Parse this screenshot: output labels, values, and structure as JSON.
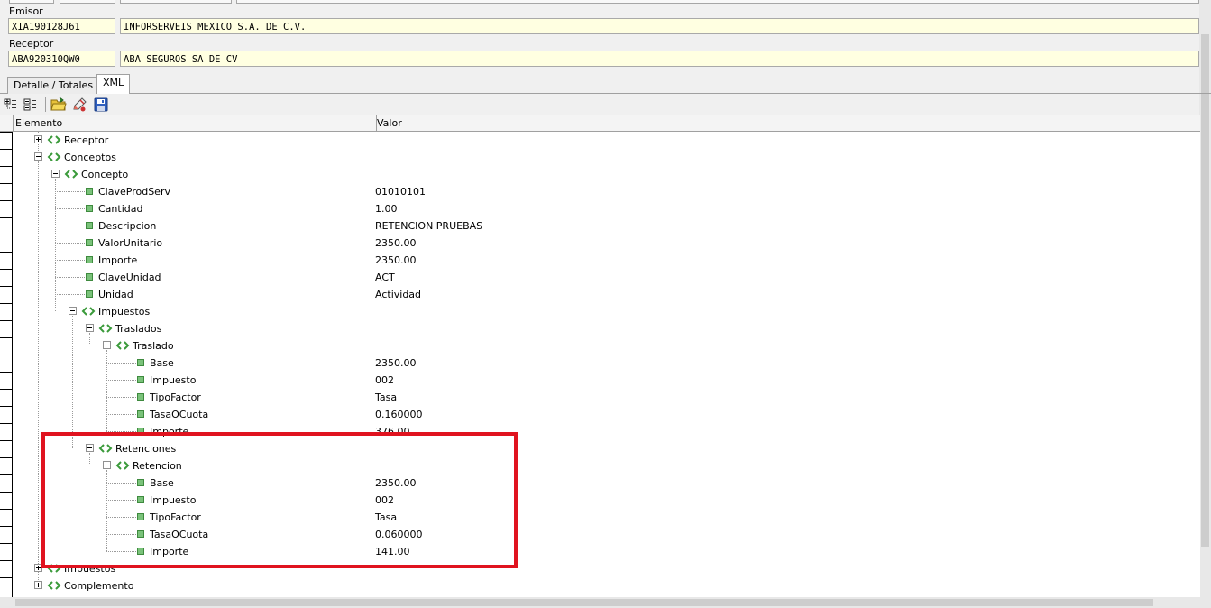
{
  "emisor": {
    "label": "Emisor",
    "rfc": "XIA190128J61",
    "name": "INFORSERVEIS MEXICO S.A. DE C.V."
  },
  "receptor": {
    "label": "Receptor",
    "rfc": "ABA920310QW0",
    "name": "ABA SEGUROS  SA DE CV"
  },
  "tabs": [
    {
      "label": "Detalle / Totales",
      "active": false
    },
    {
      "label": "XML",
      "active": true
    }
  ],
  "toolbar": {
    "buttons": [
      {
        "icon": "expand-all-icon"
      },
      {
        "icon": "collapse-all-icon"
      },
      {
        "icon": "open-folder-icon"
      },
      {
        "icon": "edit-pencil-icon"
      },
      {
        "icon": "save-disk-icon"
      }
    ]
  },
  "grid": {
    "columns": [
      "Elemento",
      "Valor"
    ],
    "rows": [
      {
        "label": "Receptor",
        "value": "",
        "level": 1,
        "type": "element",
        "expander": "plus"
      },
      {
        "label": "Conceptos",
        "value": "",
        "level": 1,
        "type": "element",
        "expander": "minus"
      },
      {
        "label": "Concepto",
        "value": "",
        "level": 2,
        "type": "element",
        "expander": "minus"
      },
      {
        "label": "ClaveProdServ",
        "value": "01010101",
        "level": 3,
        "type": "attr"
      },
      {
        "label": "Cantidad",
        "value": "1.00",
        "level": 3,
        "type": "attr"
      },
      {
        "label": "Descripcion",
        "value": "RETENCION PRUEBAS",
        "level": 3,
        "type": "attr"
      },
      {
        "label": "ValorUnitario",
        "value": "2350.00",
        "level": 3,
        "type": "attr"
      },
      {
        "label": "Importe",
        "value": "2350.00",
        "level": 3,
        "type": "attr"
      },
      {
        "label": "ClaveUnidad",
        "value": "ACT",
        "level": 3,
        "type": "attr"
      },
      {
        "label": "Unidad",
        "value": "Actividad",
        "level": 3,
        "type": "attr"
      },
      {
        "label": "Impuestos",
        "value": "",
        "level": 3,
        "type": "element",
        "expander": "minus"
      },
      {
        "label": "Traslados",
        "value": "",
        "level": 4,
        "type": "element",
        "expander": "minus"
      },
      {
        "label": "Traslado",
        "value": "",
        "level": 5,
        "type": "element",
        "expander": "minus"
      },
      {
        "label": "Base",
        "value": "2350.00",
        "level": 6,
        "type": "attr"
      },
      {
        "label": "Impuesto",
        "value": "002",
        "level": 6,
        "type": "attr"
      },
      {
        "label": "TipoFactor",
        "value": "Tasa",
        "level": 6,
        "type": "attr"
      },
      {
        "label": "TasaOCuota",
        "value": "0.160000",
        "level": 6,
        "type": "attr"
      },
      {
        "label": "Importe",
        "value": "376.00",
        "level": 6,
        "type": "attr"
      },
      {
        "label": "Retenciones",
        "value": "",
        "level": 4,
        "type": "element",
        "expander": "minus"
      },
      {
        "label": "Retencion",
        "value": "",
        "level": 5,
        "type": "element",
        "expander": "minus"
      },
      {
        "label": "Base",
        "value": "2350.00",
        "level": 6,
        "type": "attr"
      },
      {
        "label": "Impuesto",
        "value": "002",
        "level": 6,
        "type": "attr"
      },
      {
        "label": "TipoFactor",
        "value": "Tasa",
        "level": 6,
        "type": "attr"
      },
      {
        "label": "TasaOCuota",
        "value": "0.060000",
        "level": 6,
        "type": "attr"
      },
      {
        "label": "Importe",
        "value": "141.00",
        "level": 6,
        "type": "attr"
      },
      {
        "label": "Impuestos",
        "value": "",
        "level": 1,
        "type": "element",
        "expander": "plus"
      },
      {
        "label": "Complemento",
        "value": "",
        "level": 1,
        "type": "element",
        "expander": "plus"
      }
    ]
  },
  "highlight": {
    "color": "#e0131f"
  }
}
